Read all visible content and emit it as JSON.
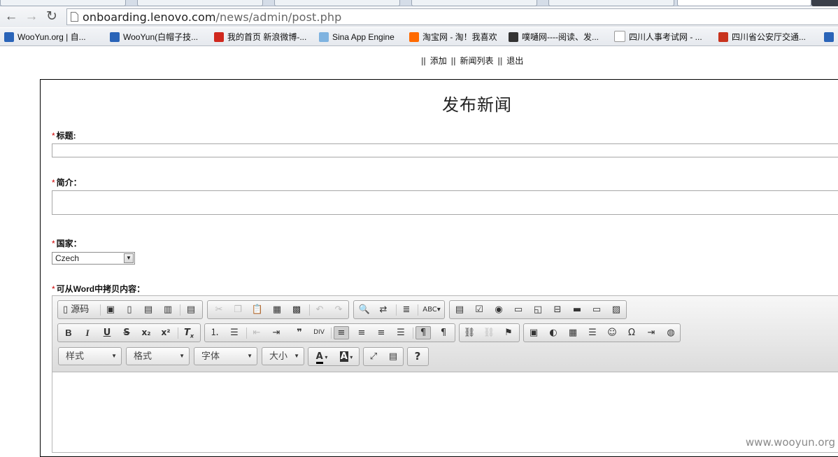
{
  "browser": {
    "url_host": "onboarding.lenovo.com",
    "url_path": "/news/admin/post.php",
    "bookmarks": [
      {
        "label": "WooYun.org | 自...",
        "icon": "wooyun-icon",
        "color": "#2a64b8"
      },
      {
        "label": "WooYun(白帽子技...",
        "icon": "wooyun-icon",
        "color": "#2a64b8"
      },
      {
        "label": "我的首页 新浪微博-...",
        "icon": "weibo-icon",
        "color": "#d0281e"
      },
      {
        "label": "Sina App Engine",
        "icon": "cloud-icon",
        "color": "#7fb3e0"
      },
      {
        "label": "淘宝网 - 淘！我喜欢",
        "icon": "taobao-icon",
        "color": "#ff6a00"
      },
      {
        "label": "噗嗵网----阅读、发...",
        "icon": "bird-icon",
        "color": "#333333"
      },
      {
        "label": "四川人事考试网 - ...",
        "icon": "page-icon",
        "color": "#ffffff"
      },
      {
        "label": "四川省公安厅交通...",
        "icon": "emblem-icon",
        "color": "#c8331e"
      }
    ]
  },
  "nav": {
    "sep": "||",
    "add": "添加",
    "list": "新闻列表",
    "logout": "退出"
  },
  "page": {
    "title": "发布新闻",
    "required_mark": "*",
    "title_label": "标题:",
    "summary_label": "简介：",
    "country_label": "国家：",
    "country_value": "Czech",
    "content_label": "可从Word中拷贝内容："
  },
  "editor": {
    "source_label": "源码",
    "combos": {
      "style": "样式",
      "format": "格式",
      "font": "字体",
      "size": "大小"
    },
    "help_label": "?"
  },
  "watermark": "www.wooyun.org"
}
